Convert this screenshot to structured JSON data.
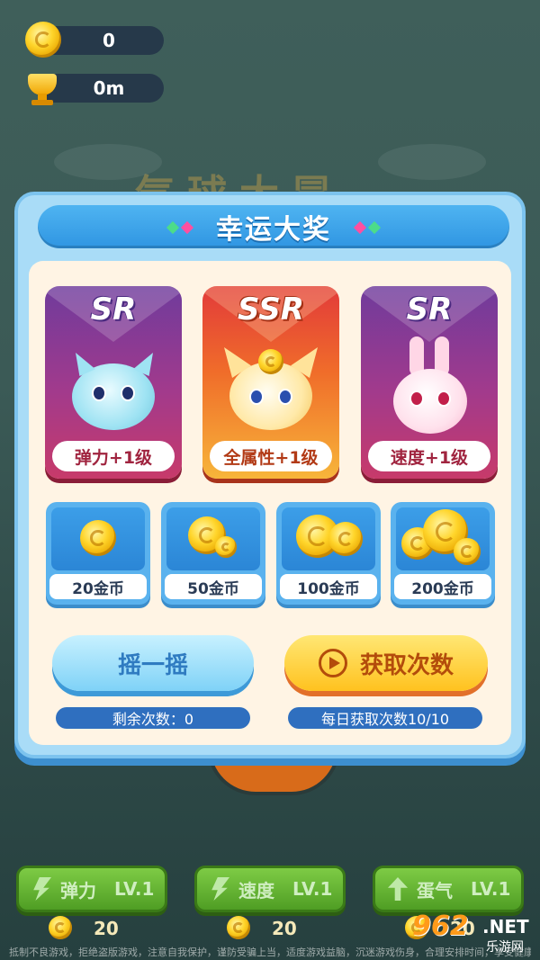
{
  "hud": {
    "coins": "0",
    "distance": "0m"
  },
  "background_title": "气球大冒",
  "modal": {
    "title": "幸运大奖",
    "cards": [
      {
        "rarity": "SR",
        "reward": "弹力+1级",
        "pet": "blue-cat"
      },
      {
        "rarity": "SSR",
        "reward": "全属性+1级",
        "pet": "yellow-fox"
      },
      {
        "rarity": "SR",
        "reward": "速度+1级",
        "pet": "pink-rabbit"
      }
    ],
    "coin_rewards": [
      "20金币",
      "50金币",
      "100金币",
      "200金币"
    ],
    "shake_button": "摇一摇",
    "get_button": "获取次数",
    "remaining": "剩余次数：0",
    "daily": "每日获取次数10/10"
  },
  "upgrades": [
    {
      "name": "弹力",
      "level": "LV.1",
      "cost": "20"
    },
    {
      "name": "速度",
      "level": "LV.1",
      "cost": "20"
    },
    {
      "name": "蛋气",
      "level": "LV.1",
      "cost": "20"
    }
  ],
  "footer": "抵制不良游戏，拒绝盗版游戏，注意自我保护，谨防受骗上当，适度游戏益脑，沉迷游戏伤身，合理安排时间，享受健康生活",
  "watermark": {
    "logo": "962",
    "net": ".NET",
    "sub": "乐游网"
  },
  "colors": {
    "accent_blue": "#2f95e2",
    "gold": "#ffc21f",
    "green": "#4f9e24"
  }
}
